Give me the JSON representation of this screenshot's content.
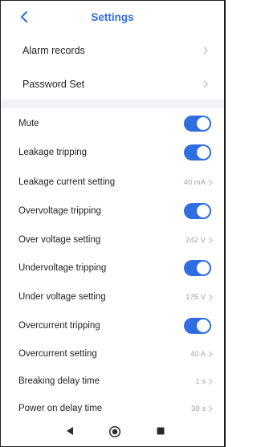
{
  "header": {
    "title": "Settings",
    "back_icon": "chevron-left-icon"
  },
  "nav_group": [
    {
      "label": "Alarm records"
    },
    {
      "label": "Password Set"
    }
  ],
  "settings": {
    "mute": {
      "label": "Mute",
      "on": true
    },
    "leakage_tripping": {
      "label": "Leakage tripping",
      "on": true
    },
    "leakage_current_setting": {
      "label": "Leakage current setting",
      "value": "40 mA"
    },
    "overvoltage_tripping": {
      "label": "Overvoltage tripping",
      "on": true
    },
    "over_voltage_setting": {
      "label": "Over voltage setting",
      "value": "242 V"
    },
    "undervoltage_tripping": {
      "label": "Undervoltage tripping",
      "on": true
    },
    "under_voltage_setting": {
      "label": "Under voltage setting",
      "value": "175 V"
    },
    "overcurrent_tripping": {
      "label": "Overcurrent tripping",
      "on": true
    },
    "overcurrent_setting": {
      "label": "Overcurrent setting",
      "value": "40 A"
    },
    "breaking_delay_time": {
      "label": "Breaking delay time",
      "value": "1 s"
    },
    "power_on_delay_time": {
      "label": "Power on delay time",
      "value": "30 s"
    }
  },
  "colors": {
    "accent": "#2f6de0",
    "muted": "#a3a3a3",
    "divider": "#f2f3f5"
  },
  "system_nav": {
    "back_icon": "triangle-back-icon",
    "home_icon": "circle-home-icon",
    "recents_icon": "square-recents-icon"
  }
}
